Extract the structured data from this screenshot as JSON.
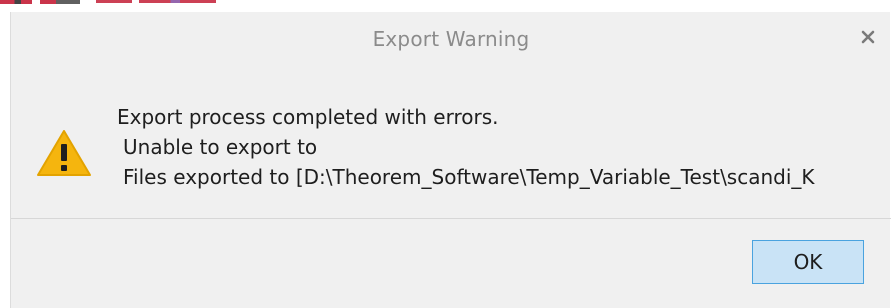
{
  "dialog": {
    "title": "Export Warning",
    "close_glyph": "×",
    "icon": "warning-triangle-icon",
    "message_lines": [
      "Export process completed with errors.",
      "Unable to export to",
      "Files exported to [D:\\Theorem_Software\\Temp_Variable_Test\\scandi_K"
    ],
    "ok_label": "OK"
  },
  "colors": {
    "dialog_bg": "#f0f0f0",
    "title_text": "#8b8b8b",
    "warning_fill": "#f5b50e",
    "ok_bg": "#c9e3f6",
    "ok_border": "#4aa3df"
  }
}
